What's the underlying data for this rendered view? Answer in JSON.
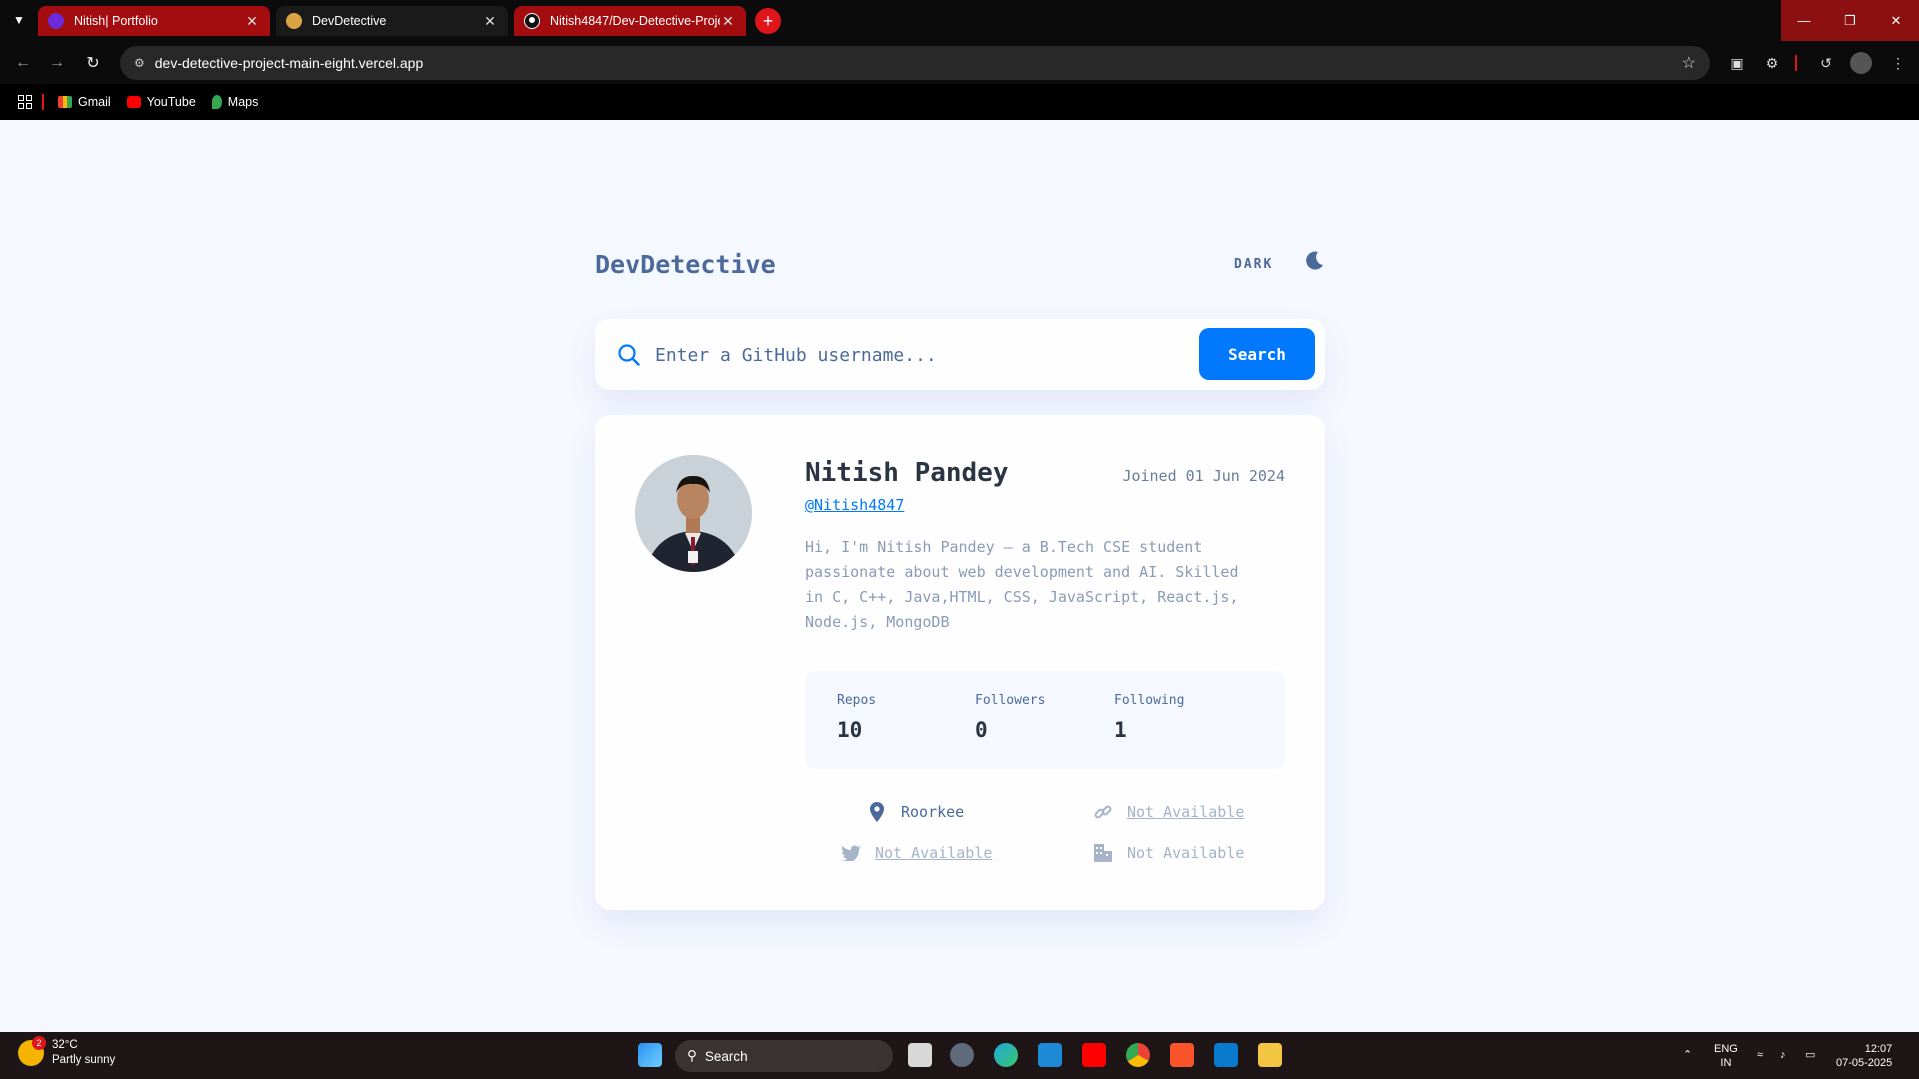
{
  "browser": {
    "tabs": [
      {
        "title": "Nitish| Portfolio",
        "active": false
      },
      {
        "title": "DevDetective",
        "active": true
      },
      {
        "title": "Nitish4847/Dev-Detective-Proje",
        "active": false
      }
    ],
    "url": "dev-detective-project-main-eight.vercel.app",
    "bookmarks": [
      "Gmail",
      "YouTube",
      "Maps"
    ]
  },
  "app": {
    "brand": "DevDetective",
    "mode_label": "DARK",
    "search": {
      "placeholder": "Enter a GitHub username...",
      "button_label": "Search"
    },
    "profile": {
      "name": "Nitish Pandey",
      "joined": "Joined 01 Jun 2024",
      "handle": "@Nitish4847",
      "bio": "Hi, I'm Nitish Pandey — a B.Tech CSE student passionate about web development and AI. Skilled in C, C++, Java,HTML, CSS, JavaScript, React.js, Node.js, MongoDB",
      "stats": {
        "repos_label": "Repos",
        "repos": "10",
        "followers_label": "Followers",
        "followers": "0",
        "following_label": "Following",
        "following": "1"
      },
      "location": "Roorkee",
      "website": "Not Available",
      "twitter": "Not Available",
      "company": "Not Available"
    }
  },
  "taskbar": {
    "weather_temp": "32°C",
    "weather_desc": "Partly sunny",
    "weather_badge": "2",
    "search_label": "Search",
    "lang_top": "ENG",
    "lang_bottom": "IN",
    "time": "12:07",
    "date": "07-05-2025"
  },
  "colors": {
    "accent": "#0079ff",
    "brand_text": "#4b6a9b",
    "page_bg": "#f6f8ff",
    "tab_red": "#a40d10"
  }
}
